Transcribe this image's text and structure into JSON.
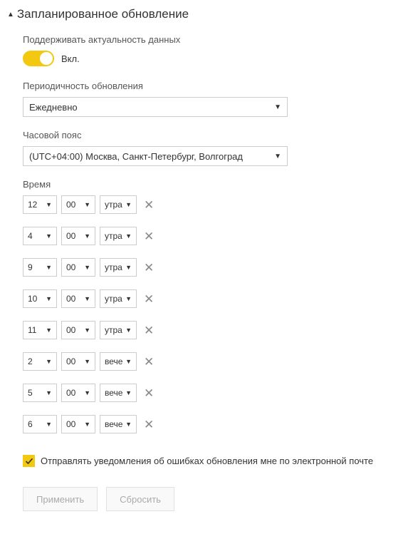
{
  "section": {
    "title": "Запланированное обновление"
  },
  "keep_data": {
    "label": "Поддерживать актуальность данных",
    "state_label": "Вкл."
  },
  "frequency": {
    "label": "Периодичность обновления",
    "value": "Ежедневно"
  },
  "timezone": {
    "label": "Часовой пояс",
    "value": "(UTC+04:00) Москва, Санкт-Петербург, Волгоград"
  },
  "time": {
    "label": "Время",
    "rows": [
      {
        "hour": "12",
        "minute": "00",
        "period": "утра"
      },
      {
        "hour": "4",
        "minute": "00",
        "period": "утра"
      },
      {
        "hour": "9",
        "minute": "00",
        "period": "утра"
      },
      {
        "hour": "10",
        "minute": "00",
        "period": "утра"
      },
      {
        "hour": "11",
        "minute": "00",
        "period": "утра"
      },
      {
        "hour": "2",
        "minute": "00",
        "period": "вече"
      },
      {
        "hour": "5",
        "minute": "00",
        "period": "вече"
      },
      {
        "hour": "6",
        "minute": "00",
        "period": "вече"
      }
    ]
  },
  "notify": {
    "label": "Отправлять уведомления об ошибках обновления мне по электронной почте",
    "checked": true
  },
  "buttons": {
    "apply": "Применить",
    "reset": "Сбросить"
  }
}
